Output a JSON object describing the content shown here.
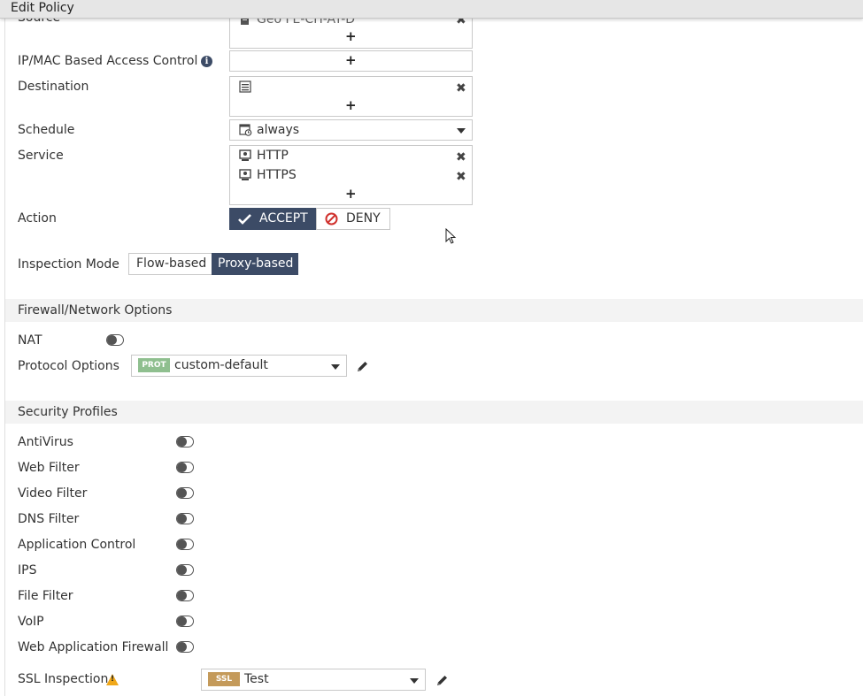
{
  "window": {
    "title": "Edit Policy"
  },
  "policy": {
    "source": {
      "label": "Source",
      "partial_entry": "Geo FE-CH-AT-D",
      "add": "+"
    },
    "ipmac": {
      "label": "IP/MAC Based Access Control",
      "add": "+"
    },
    "destination": {
      "label": "Destination",
      "add": "+"
    },
    "schedule": {
      "label": "Schedule",
      "value": "always"
    },
    "service": {
      "label": "Service",
      "entries": [
        "HTTP",
        "HTTPS"
      ],
      "add": "+"
    },
    "action": {
      "label": "Action",
      "accept": "ACCEPT",
      "deny": "DENY"
    },
    "inspection": {
      "label": "Inspection Mode",
      "flow": "Flow-based",
      "proxy": "Proxy-based",
      "selected": "Proxy-based"
    }
  },
  "firewall": {
    "header": "Firewall/Network Options",
    "nat": "NAT",
    "protocol_options": {
      "label": "Protocol Options",
      "badge": "PROT",
      "value": "custom-default"
    }
  },
  "security": {
    "header": "Security Profiles",
    "profiles": [
      "AntiVirus",
      "Web Filter",
      "Video Filter",
      "DNS Filter",
      "Application Control",
      "IPS",
      "File Filter",
      "VoIP",
      "Web Application Firewall"
    ],
    "ssl": {
      "label": "SSL Inspection",
      "badge": "SSL",
      "value": "Test"
    }
  },
  "colors": {
    "accent": "#3c4b66",
    "prot_badge": "#8fbf8f",
    "ssl_badge": "#c49a5a",
    "deny_icon": "#d0312d",
    "warning": "#f0a81a"
  },
  "icons": [
    "address-icon",
    "schedule-icon",
    "service-icon",
    "info-icon",
    "check-icon",
    "deny-icon",
    "pencil-icon",
    "warning-icon",
    "close-icon",
    "caret-down-icon"
  ]
}
